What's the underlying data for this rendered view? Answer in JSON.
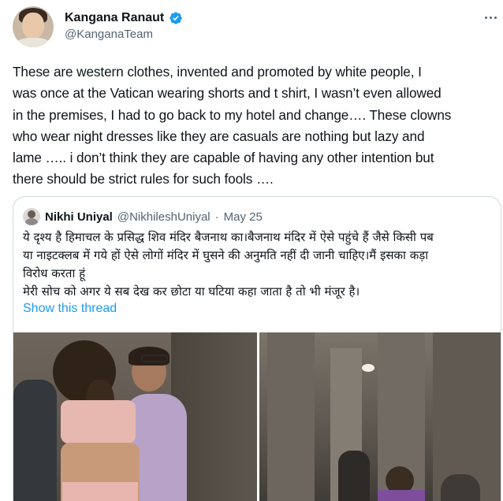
{
  "author": {
    "display_name": "Kangana Ranaut",
    "handle": "@KanganaTeam",
    "verified": true,
    "verified_color": "#1d9bf0"
  },
  "tweet": {
    "lines": [
      "These are western clothes, invented and promoted by white people, I",
      "was once at the Vatican wearing shorts and t shirt, I wasn’t even allowed",
      "in the premises, I had to go back to my hotel and change…. These clowns",
      "who wear night dresses like they are casuals are nothing but lazy and",
      "lame ….. i don’t think they are capable of having any other intention but",
      "there should be strict rules for such fools …."
    ]
  },
  "quoted_tweet": {
    "display_name": "Nikhi Uniyal",
    "handle": "@NikhileshUniyal",
    "separator": "·",
    "date": "May 25",
    "lines": [
      "ये दृश्य है हिमाचल के प्रसिद्ध शिव मंदिर बैजनाथ का।बैजनाथ मंदिर में ऐसे पहुंचे हैं जैसे किसी पब",
      "या नाइटक्लब में गये हों ऐसे लोगों मंदिर में घुसने की अनुमति नहीं दी जानी चाहिए।मैं इसका कड़ा",
      "विरोध करता हूं",
      " मेरी सोच को अगर ये सब देख कर छोटा या घटिया कहा जाता है तो भी मंजूर है।"
    ],
    "show_thread_label": "Show this thread",
    "link_color": "#1d9bf0"
  }
}
